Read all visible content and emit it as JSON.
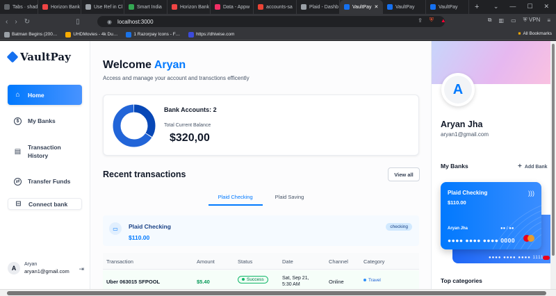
{
  "browser": {
    "tabs": [
      {
        "title": "Tabs · shadc",
        "color": "#5f6368"
      },
      {
        "title": "Horizon Bank",
        "color": "#ef4444"
      },
      {
        "title": "Use Ref in Cl",
        "color": "#9aa0a6"
      },
      {
        "title": "Smart India",
        "color": "#34a853"
      },
      {
        "title": "Horizon Bank",
        "color": "#ef4444"
      },
      {
        "title": "Data - Appw",
        "color": "#f02e65"
      },
      {
        "title": "accounts-sa",
        "color": "#ea4335"
      },
      {
        "title": "Plaid - Dashb",
        "color": "#9aa0a6"
      },
      {
        "title": "VaultPay",
        "color": "#1570ef"
      },
      {
        "title": "VaultPay",
        "color": "#1570ef"
      },
      {
        "title": "VaultPay",
        "color": "#1570ef"
      }
    ],
    "active_tab_index": 8,
    "new_tab": "+",
    "url": "localhost:3000",
    "vpn_label": "VPN",
    "bookmarks": [
      {
        "label": "Batman Begins (200…",
        "color": "#9aa0a6"
      },
      {
        "label": "UHDMovies - 4k Du…",
        "color": "#f9ab00"
      },
      {
        "label": "1 Razorpay Icons - F…",
        "color": "#1a73e8"
      },
      {
        "label": "https://dhiwise.com",
        "color": "#3c4bdc"
      }
    ],
    "all_bookmarks": "All Bookmarks"
  },
  "sidebar": {
    "brand": "VaultPay",
    "items": [
      {
        "label": "Home",
        "icon": "home-icon",
        "glyph": "⌂"
      },
      {
        "label": "My Banks",
        "icon": "dollar-circle-icon",
        "glyph": "$"
      },
      {
        "label": "Transaction",
        "label2": "History",
        "icon": "receipt-icon",
        "glyph": "▤"
      },
      {
        "label": "Transfer Funds",
        "icon": "money-send-icon",
        "glyph": "⇄"
      },
      {
        "label": "Connect bank",
        "icon": "connect-bank-icon",
        "glyph": "⊟"
      }
    ],
    "footer": {
      "avatar": "A",
      "name": "Aryan",
      "email": "aryan1@gmail.com"
    }
  },
  "main": {
    "welcome_prefix": "Welcome",
    "welcome_name": "Aryan",
    "subtitle": "Access and manage your account and transctions efficently",
    "balance_card": {
      "accounts_label": "Bank Accounts: 2",
      "total_label": "Total Current Balance",
      "total_value": "$320,00"
    },
    "recent_title": "Recent transactions",
    "view_all": "View all",
    "bank_tabs": [
      "Plaid Checking",
      "Plaid Saving"
    ],
    "bank_info": {
      "name": "Plaid Checking",
      "amount": "$110.00",
      "badge": "checking"
    },
    "table": {
      "headers": [
        "Transaction",
        "Amount",
        "Status",
        "Date",
        "Channel",
        "Category"
      ],
      "rows": [
        {
          "merchant": "Uber 063015 SFPOOL",
          "amount": "$5.40",
          "status": "Success",
          "date1": "Sat, Sep 21,",
          "date2": "5:30 AM",
          "channel": "Online",
          "category": "Travel"
        }
      ]
    }
  },
  "right": {
    "avatar": "A",
    "name": "Aryan Jha",
    "email": "aryan1@gmail.com",
    "my_banks": "My Banks",
    "add_bank": "Add Bank",
    "card": {
      "name": "Plaid Checking",
      "amount": "$110.00",
      "holder": "Aryan Jha",
      "expiry": "●● / ●●",
      "number": "●●●● ●●●● ●●●● 0000"
    },
    "card_back": {
      "number": "●●●● ●●●● ●●●● 1111"
    },
    "top_categories": "Top categories"
  },
  "chart_data": {
    "type": "pie",
    "categories": [
      "Plaid Checking",
      "Plaid Saving"
    ],
    "values": [
      110,
      210
    ]
  }
}
